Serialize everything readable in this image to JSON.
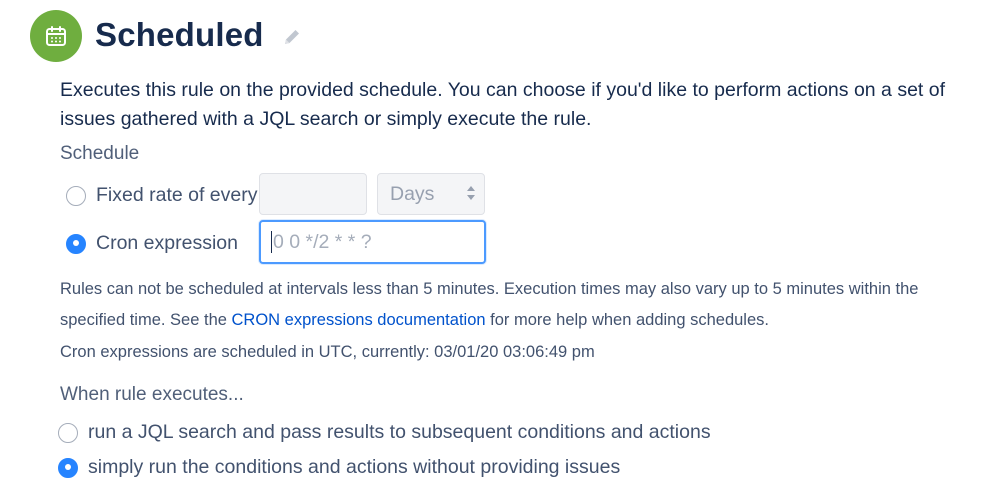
{
  "header": {
    "title": "Scheduled",
    "icon": "calendar-icon",
    "edit_icon": "pencil-icon",
    "icon_color": "#6fae3f"
  },
  "description": "Executes this rule on the provided schedule. You can choose if you'd like to perform actions on a set of issues gathered with a JQL search or simply execute the rule.",
  "schedule": {
    "label": "Schedule",
    "fixed_rate": {
      "label": "Fixed rate of every",
      "checked": false,
      "value": "",
      "unit": "Days"
    },
    "cron": {
      "label": "Cron expression",
      "checked": true,
      "value": "",
      "placeholder": "0 0 */2 * * ?"
    }
  },
  "help": {
    "text_before": "Rules can not be scheduled at intervals less than 5 minutes. Execution times may also vary up to 5 minutes within the specified time. See the ",
    "link_text": "CRON expressions documentation",
    "text_after": " for more help when adding schedules.",
    "utc_note": "Cron expressions are scheduled in UTC, currently: 03/01/20 03:06:49 pm"
  },
  "execution": {
    "label": "When rule executes...",
    "options": [
      {
        "label": "run a JQL search and pass results to subsequent conditions and actions",
        "checked": false
      },
      {
        "label": "simply run the conditions and actions without providing issues",
        "checked": true
      }
    ]
  },
  "colors": {
    "accent": "#2684ff",
    "link": "#0052cc",
    "text": "#172b4d"
  }
}
